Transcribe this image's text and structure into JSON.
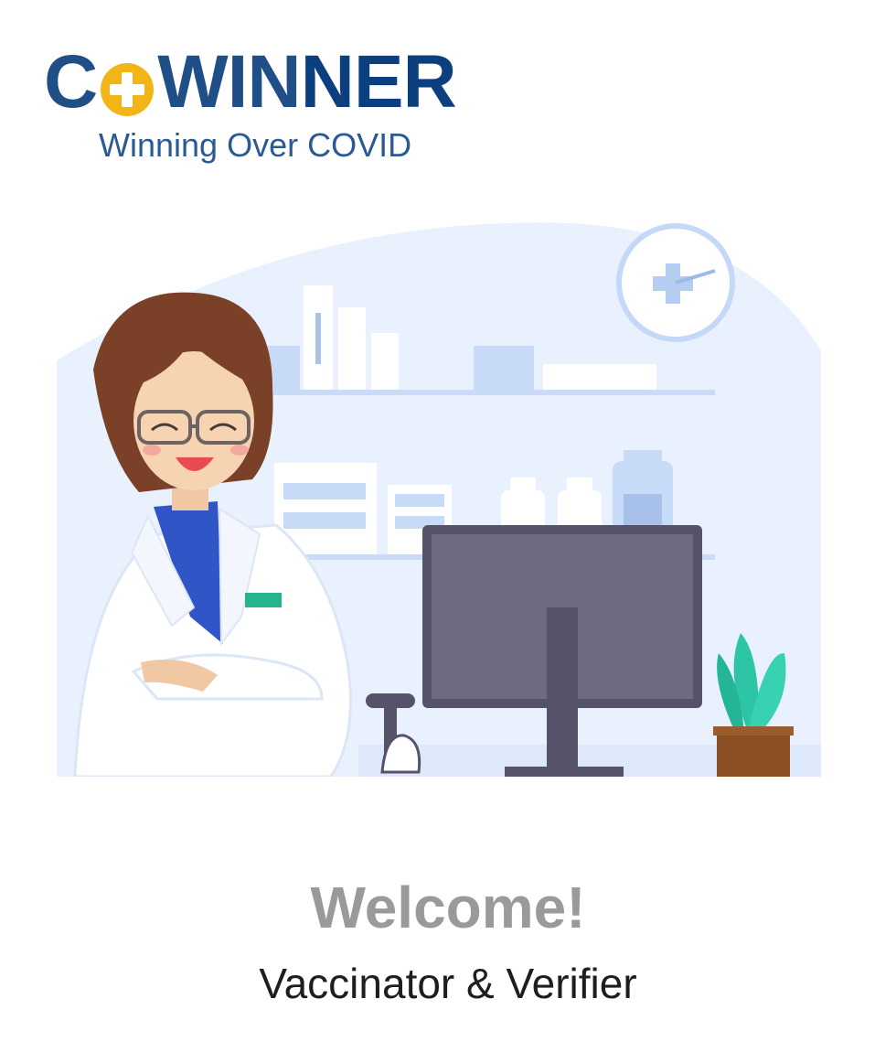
{
  "logo": {
    "part_c": "C",
    "part_win": "WIN",
    "part_ner": "NER",
    "tagline": "Winning Over COVID",
    "icon": "plus-circle-icon",
    "accent_color": "#f2b517",
    "brand_color": "#1f4f86"
  },
  "illustration": {
    "subject": "doctor-at-desk-illustration"
  },
  "welcome": {
    "title": "Welcome!",
    "subtitle": "Vaccinator & Verifier"
  }
}
